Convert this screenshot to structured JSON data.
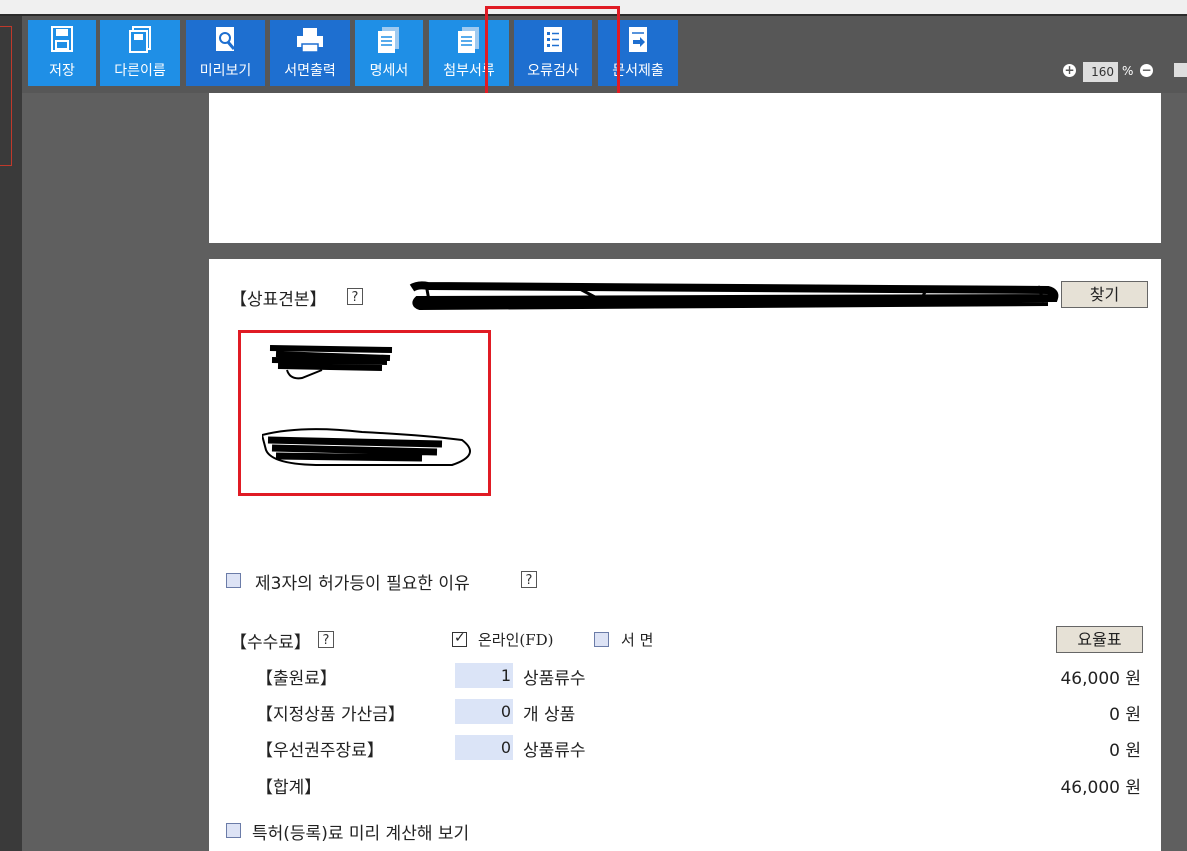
{
  "toolbar": {
    "buttons": [
      {
        "label": "저장",
        "icon": "save-icon"
      },
      {
        "label": "다른이름",
        "icon": "save-as-icon"
      },
      {
        "label": "미리보기",
        "icon": "preview-icon"
      },
      {
        "label": "서면출력",
        "icon": "print-icon"
      },
      {
        "label": "명세서",
        "icon": "document-icon"
      },
      {
        "label": "첨부서류",
        "icon": "attachment-icon"
      },
      {
        "label": "오류검사",
        "icon": "error-check-icon"
      },
      {
        "label": "문서제출",
        "icon": "submit-icon"
      }
    ],
    "zoom": {
      "value": "160",
      "unit": "%"
    }
  },
  "form": {
    "specimen_label": "【상표견본】",
    "help": "?",
    "find_button": "찾기",
    "third_party_reason": "제3자의 허가등이 필요한 이유",
    "fee_label": "【수수료】",
    "online_label": "온라인(FD)",
    "paper_label": "서 면",
    "rate_table_button": "요율표",
    "online_checked": true,
    "paper_checked": false,
    "fees": [
      {
        "label": "【출원료】",
        "count": "1",
        "unit": "상품류수",
        "amount": "46,000 원"
      },
      {
        "label": "【지정상품 가산금】",
        "count": "0",
        "unit": "개 상품",
        "amount": "0 원"
      },
      {
        "label": "【우선권주장료】",
        "count": "0",
        "unit": "상품류수",
        "amount": "0 원"
      }
    ],
    "total_label": "【합계】",
    "total_amount": "46,000 원",
    "precalc_label": "특허(등록)료 미리 계산해 보기"
  },
  "colors": {
    "toolbar_button": "#1f8fe6",
    "highlight": "#e01b24"
  }
}
